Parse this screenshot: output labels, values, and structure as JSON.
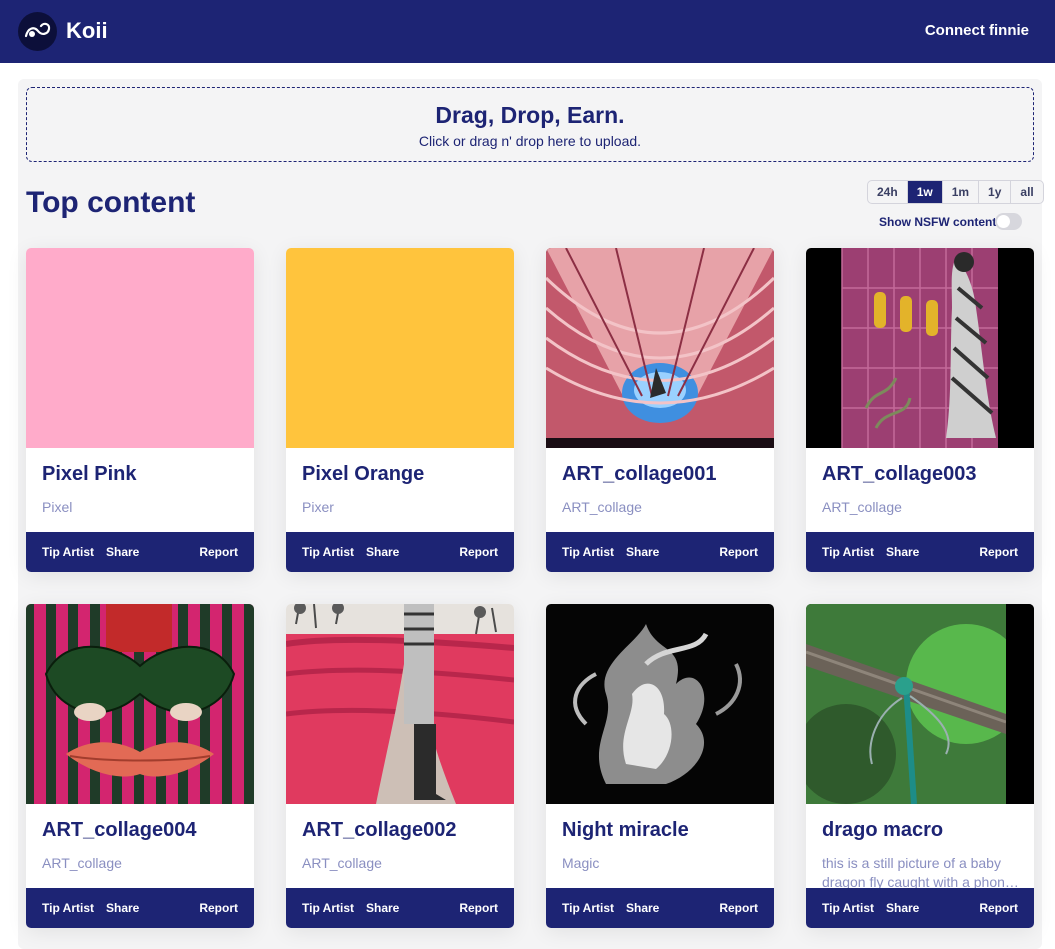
{
  "header": {
    "brand": "Koii",
    "connect_label": "Connect finnie",
    "logo_icon": "koii-logo-icon"
  },
  "upload": {
    "title": "Drag, Drop, Earn.",
    "subtitle": "Click or drag n' drop here to upload."
  },
  "content": {
    "title": "Top content",
    "ranges": [
      "24h",
      "1w",
      "1m",
      "1y",
      "all"
    ],
    "active_range": "1w",
    "nsfw_label": "Show NSFW content",
    "nsfw_enabled": false
  },
  "card_actions": {
    "tip": "Tip Artist",
    "share": "Share",
    "report": "Report"
  },
  "cards": [
    {
      "title": "Pixel Pink",
      "subtitle": "Pixel",
      "image_color": "#ffabca"
    },
    {
      "title": "Pixel Orange",
      "subtitle": "Pixer",
      "image_color": "#ffc43d"
    },
    {
      "title": "ART_collage001",
      "subtitle": "ART_collage"
    },
    {
      "title": "ART_collage003",
      "subtitle": "ART_collage"
    },
    {
      "title": "ART_collage004",
      "subtitle": "ART_collage"
    },
    {
      "title": "ART_collage002",
      "subtitle": "ART_collage"
    },
    {
      "title": "Night miracle",
      "subtitle": "Magic"
    },
    {
      "title": "drago macro",
      "subtitle": "this is a still picture of a baby dragon fly caught with a phone camera"
    }
  ],
  "colors": {
    "nav": "#1d2474",
    "accent_text": "#1d2474",
    "muted_text": "#8a8fc1",
    "panel": "#f4f4f5"
  }
}
